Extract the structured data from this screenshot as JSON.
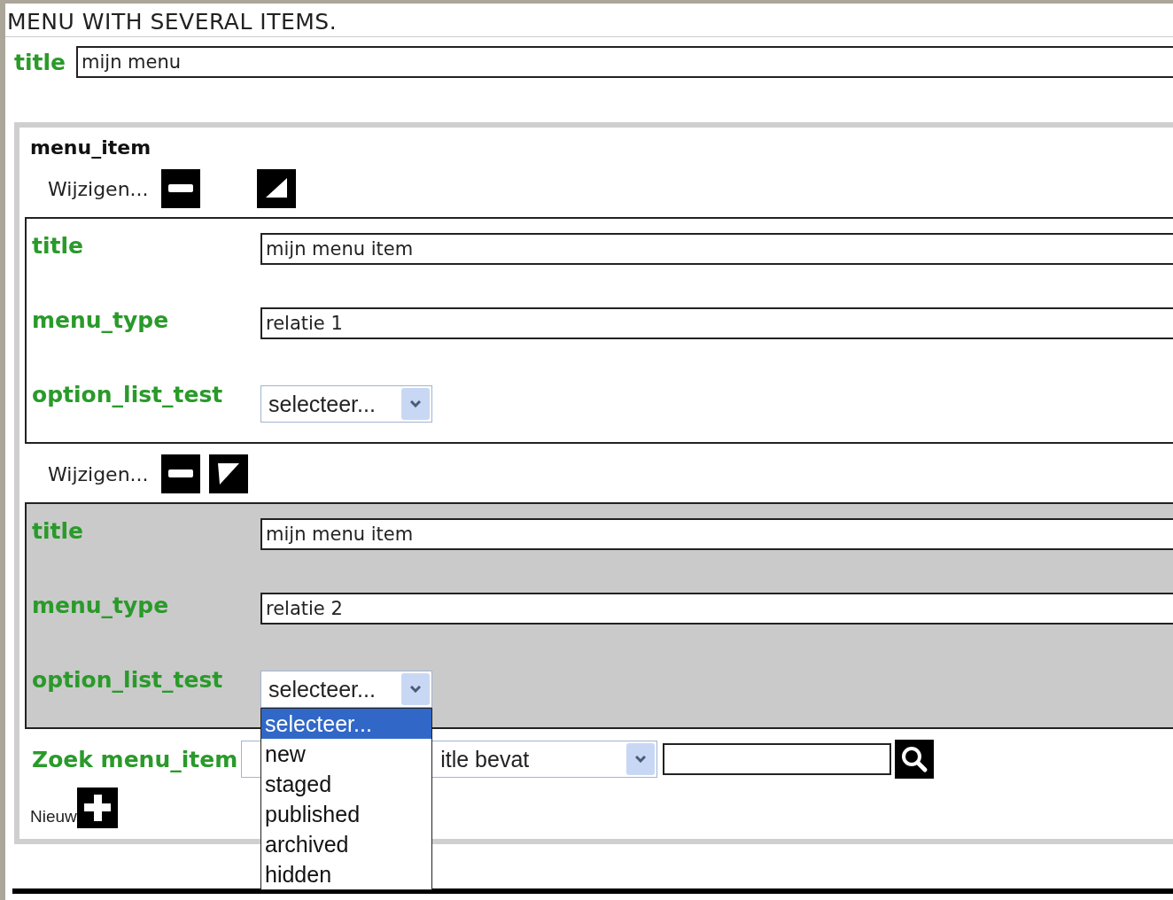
{
  "heading": "MENU WITH SEVERAL ITEMS.",
  "title_field": {
    "label": "title",
    "value": "mijn menu"
  },
  "section": {
    "title": "menu_item",
    "items": [
      {
        "edit_label": "Wijzigen...",
        "selected": false,
        "fields": [
          {
            "kind": "text",
            "label": "title",
            "value": "mijn menu item"
          },
          {
            "kind": "text",
            "label": "menu_type",
            "value": "relatie 1"
          },
          {
            "kind": "select",
            "label": "option_list_test",
            "value": "selecteer...",
            "expanded": false
          }
        ]
      },
      {
        "edit_label": "Wijzigen...",
        "selected": true,
        "fields": [
          {
            "kind": "text",
            "label": "title",
            "value": "mijn menu item"
          },
          {
            "kind": "text",
            "label": "menu_type",
            "value": "relatie 2"
          },
          {
            "kind": "select",
            "label": "option_list_test",
            "value": "selecteer...",
            "expanded": true,
            "options": [
              {
                "label": "selecteer...",
                "selected": true
              },
              {
                "label": "new",
                "selected": false
              },
              {
                "label": "staged",
                "selected": false
              },
              {
                "label": "published",
                "selected": false
              },
              {
                "label": "archived",
                "selected": false
              },
              {
                "label": "hidden",
                "selected": false
              }
            ]
          }
        ]
      }
    ],
    "search": {
      "label": "Zoek menu_item",
      "filter_value": "itle bevat"
    },
    "new_label": "Nieuw"
  }
}
